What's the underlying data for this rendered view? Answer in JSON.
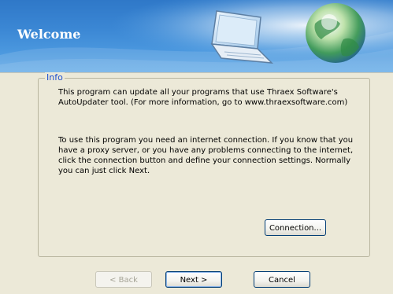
{
  "banner": {
    "title": "Welcome",
    "laptop_icon": "laptop-icon",
    "globe_icon": "globe-icon"
  },
  "info": {
    "legend": "Info",
    "paragraph1": "This program can update all your programs that use Thraex Software's\nAutoUpdater tool. (For more information, go to www.thraexsoftware.com)",
    "paragraph2": "To use this program you need an internet connection. If you know that you\nhave a proxy server, or you have any problems connecting to the internet,\nclick the connection button and define your connection settings. Normally\nyou can just click Next."
  },
  "buttons": {
    "connection": "Connection...",
    "back": "< Back",
    "next": "Next >",
    "cancel": "Cancel"
  },
  "colors": {
    "banner_blue": "#3b87d4",
    "legend_blue": "#1d4fcf",
    "dialog_bg": "#ece9d8"
  }
}
